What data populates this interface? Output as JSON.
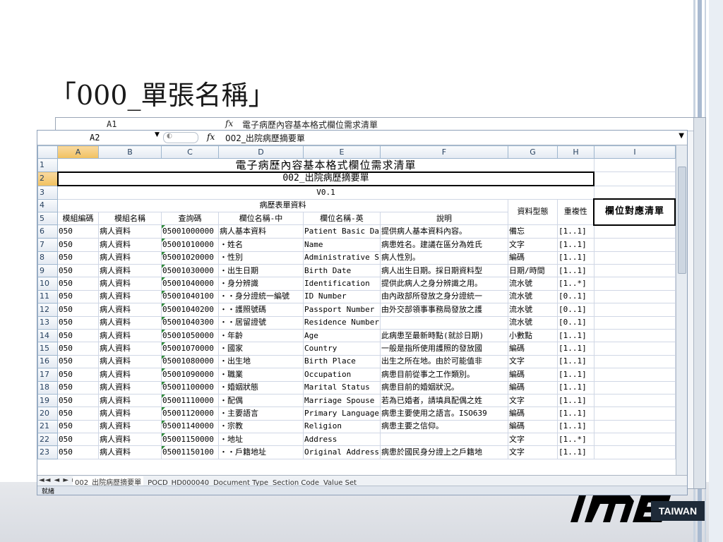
{
  "slide": {
    "title": "「000_單張名稱」"
  },
  "back_window": {
    "cell_ref": "A1",
    "fx": "fx",
    "content": "電子病歷內容基本格式欄位需求清單"
  },
  "formula_bar": {
    "cell_ref": "A2",
    "fx": "fx",
    "content": "002_出院病歷摘要單"
  },
  "columns": [
    "A",
    "B",
    "C",
    "D",
    "E",
    "F",
    "G",
    "H",
    "I"
  ],
  "rows": {
    "r1": {
      "num": "1",
      "text": "電子病歷內容基本格式欄位需求清單"
    },
    "r2": {
      "num": "2",
      "text": "002_出院病歷摘要單"
    },
    "r3": {
      "num": "3",
      "text": "V0.1"
    },
    "r4": {
      "num": "4",
      "text": "病歷表單資料",
      "g": "資料型態",
      "h": "重複性",
      "i": "欄位對應清單"
    },
    "r5": {
      "num": "5",
      "cells": [
        "模組編碼",
        "模組名稱",
        "查詢碼",
        "欄位名稱-中",
        "欄位名稱-英",
        "說明"
      ]
    }
  },
  "data_rows": [
    {
      "num": "6",
      "a": "050",
      "b": "病人資料",
      "c": "05001000000",
      "d": "病人基本資料",
      "e": "Patient Basic Da",
      "f": "提供病人基本資料內容。",
      "g": "備忘",
      "h": "[1..1]"
    },
    {
      "num": "7",
      "a": "050",
      "b": "病人資料",
      "c": "05001010000",
      "d": "・姓名",
      "e": "Name",
      "f": "病患姓名。建議在區分為姓氏",
      "g": "文字",
      "h": "[1..1]"
    },
    {
      "num": "8",
      "a": "050",
      "b": "病人資料",
      "c": "05001020000",
      "d": "・性別",
      "e": "Administrative S",
      "f": "病人性別。",
      "g": "編碼",
      "h": "[1..1]"
    },
    {
      "num": "9",
      "a": "050",
      "b": "病人資料",
      "c": "05001030000",
      "d": "・出生日期",
      "e": "Birth Date",
      "f": "病人出生日期。採日期資料型",
      "g": "日期/時間",
      "h": "[1..1]"
    },
    {
      "num": "10",
      "a": "050",
      "b": "病人資料",
      "c": "05001040000",
      "d": "・身分辨識",
      "e": "Identification",
      "f": "提供此病人之身分辨識之用。",
      "g": "流水號",
      "h": "[1..*]"
    },
    {
      "num": "11",
      "a": "050",
      "b": "病人資料",
      "c": "05001040100",
      "d": "・・身分證統一編號",
      "e": "ID Number",
      "f": "由內政部所發放之身分證統一",
      "g": "流水號",
      "h": "[0..1]"
    },
    {
      "num": "12",
      "a": "050",
      "b": "病人資料",
      "c": "05001040200",
      "d": "・・護照號碼",
      "e": "Passport Number",
      "f": "由外交部領事事務局發放之護",
      "g": "流水號",
      "h": "[0..1]"
    },
    {
      "num": "13",
      "a": "050",
      "b": "病人資料",
      "c": "05001040300",
      "d": "・・居留證號",
      "e": "Residence Number",
      "f": "",
      "g": "流水號",
      "h": "[0..1]"
    },
    {
      "num": "14",
      "a": "050",
      "b": "病人資料",
      "c": "05001050000",
      "d": "・年齡",
      "e": "Age",
      "f": "此病患至最新時點(就診日期)",
      "g": "小數點",
      "h": "[1..1]"
    },
    {
      "num": "15",
      "a": "050",
      "b": "病人資料",
      "c": "05001070000",
      "d": "・國家",
      "e": "Country",
      "f": "一般是指所使用護照的發放國",
      "g": "編碼",
      "h": "[1..1]"
    },
    {
      "num": "16",
      "a": "050",
      "b": "病人資料",
      "c": "05001080000",
      "d": "・出生地",
      "e": "Birth Place",
      "f": "出生之所在地。由於可能值非",
      "g": "文字",
      "h": "[1..1]"
    },
    {
      "num": "17",
      "a": "050",
      "b": "病人資料",
      "c": "05001090000",
      "d": "・職業",
      "e": "Occupation",
      "f": "病患目前從事之工作類別。",
      "g": "編碼",
      "h": "[1..1]"
    },
    {
      "num": "18",
      "a": "050",
      "b": "病人資料",
      "c": "05001100000",
      "d": "・婚姻狀態",
      "e": "Marital Status",
      "f": "病患目前的婚姻狀況。",
      "g": "編碼",
      "h": "[1..1]"
    },
    {
      "num": "19",
      "a": "050",
      "b": "病人資料",
      "c": "05001110000",
      "d": "・配偶",
      "e": "Marriage Spouse",
      "f": "若為已婚者，請填具配偶之姓",
      "g": "文字",
      "h": "[1..1]"
    },
    {
      "num": "20",
      "a": "050",
      "b": "病人資料",
      "c": "05001120000",
      "d": "・主要語言",
      "e": "Primary Language",
      "f": "病患主要使用之語言。ISO639",
      "g": "編碼",
      "h": "[1..1]"
    },
    {
      "num": "21",
      "a": "050",
      "b": "病人資料",
      "c": "05001140000",
      "d": "・宗教",
      "e": "Religion",
      "f": "病患主要之信仰。",
      "g": "編碼",
      "h": "[1..1]"
    },
    {
      "num": "22",
      "a": "050",
      "b": "病人資料",
      "c": "05001150000",
      "d": "・地址",
      "e": "Address",
      "f": "",
      "g": "文字",
      "h": "[1..*]"
    },
    {
      "num": "23",
      "a": "050",
      "b": "病人資料",
      "c": "05001150100",
      "d": "・・戶籍地址",
      "e": "Original Address",
      "f": "病患於國民身分證上之戶籍地",
      "g": "文字",
      "h": "[1..1]"
    }
  ],
  "sheet_tabs": [
    "002_出院病歷摘要單",
    "POCD_HD000040",
    "Document Type",
    "Section Code",
    "Value Set"
  ],
  "status": {
    "label": "就緒"
  },
  "logo": {
    "text": "TAIWAN"
  }
}
